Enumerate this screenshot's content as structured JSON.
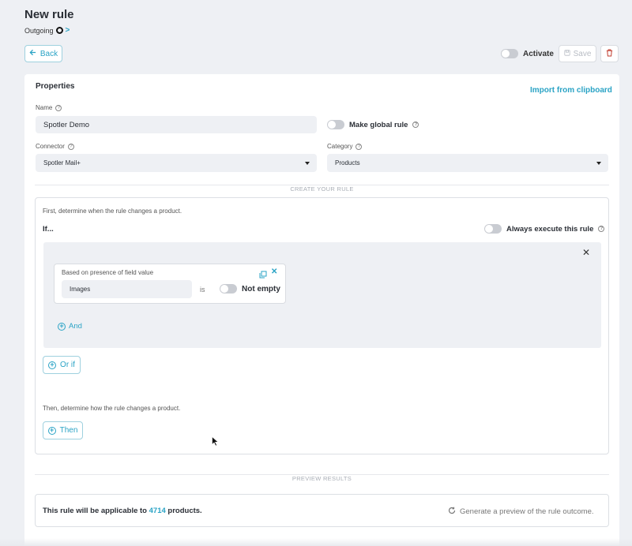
{
  "page": {
    "title": "New rule",
    "breadcrumb": "Outgoing"
  },
  "toolbar": {
    "back": "Back",
    "activate": "Activate",
    "save": "Save"
  },
  "properties": {
    "heading": "Properties",
    "import_link": "Import from clipboard",
    "name_label": "Name",
    "name_value": "Spotler Demo",
    "global_rule_label": "Make global rule",
    "connector_label": "Connector",
    "connector_value": "Spotler Mail+",
    "category_label": "Category",
    "category_value": "Products"
  },
  "rule": {
    "section_title": "CREATE YOUR RULE",
    "first_text": "First, determine when the rule changes a product.",
    "if_label": "If...",
    "always_label": "Always execute this rule",
    "condition": {
      "title": "Based on presence of field value",
      "field": "Images",
      "operator": "is",
      "toggle_label": "Not empty"
    },
    "and_label": "And",
    "or_if_label": "Or if",
    "then_text": "Then, determine how the rule changes a product.",
    "then_label": "Then"
  },
  "preview": {
    "section_title": "PREVIEW RESULTS",
    "text_prefix": "This rule will be applicable to",
    "count": "4714",
    "text_suffix": "products.",
    "generate_label": "Generate a preview of the rule outcome."
  },
  "colors": {
    "accent": "#2aa3c5",
    "background": "#eef0f4"
  }
}
